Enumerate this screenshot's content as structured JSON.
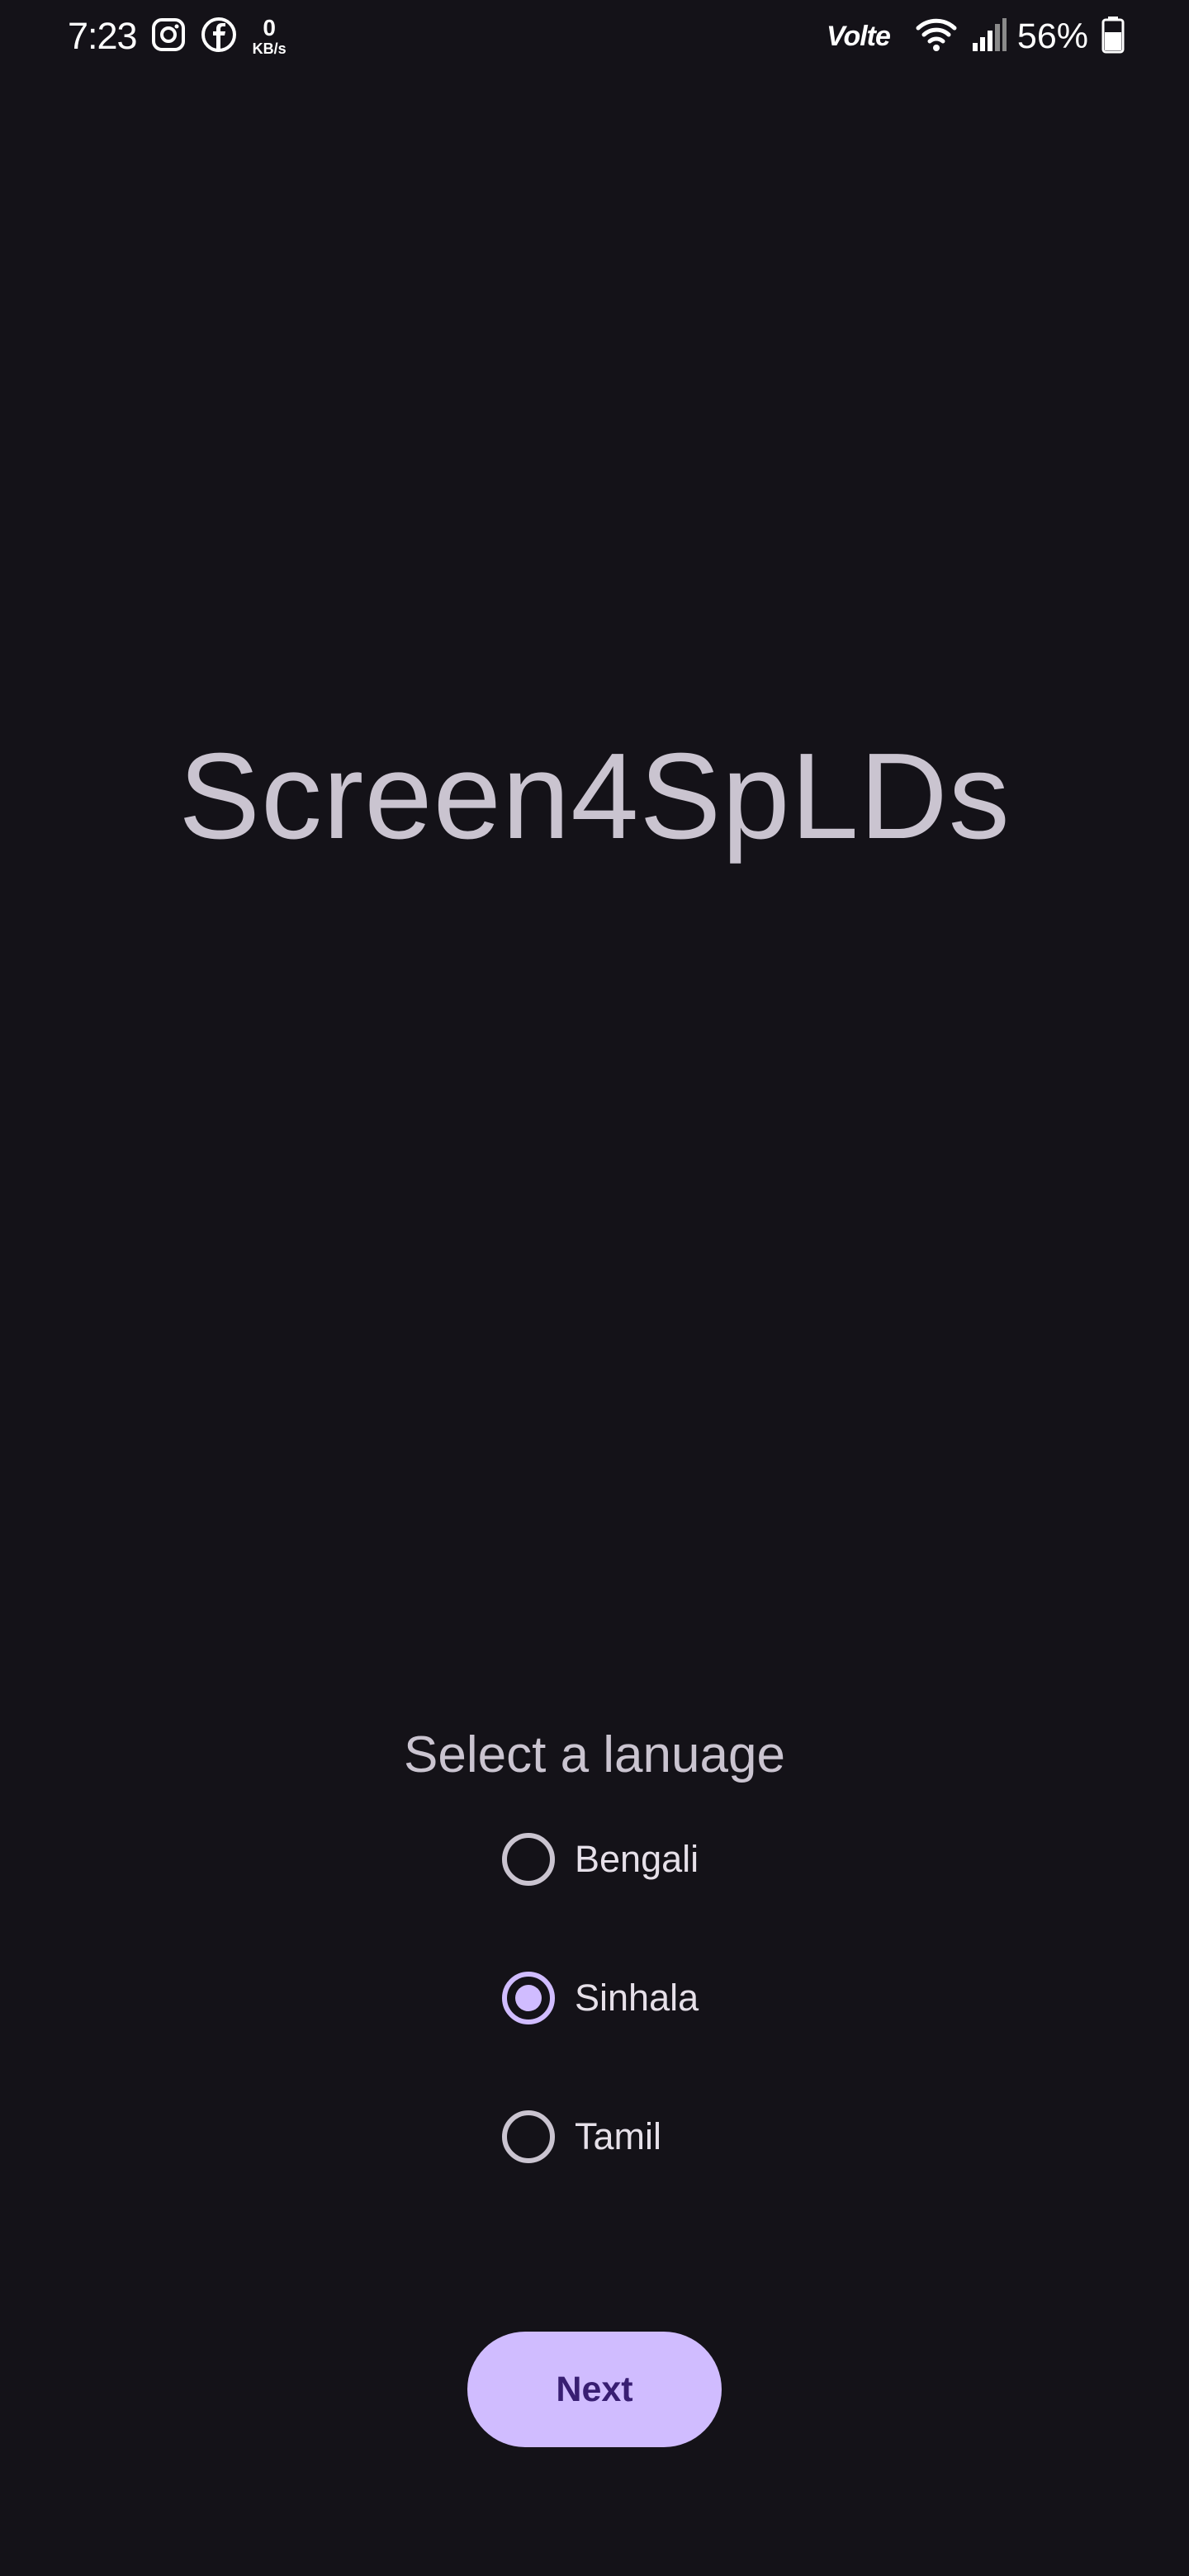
{
  "status_bar": {
    "time": "7:23",
    "left_icons": [
      "instagram-icon",
      "facebook-icon"
    ],
    "network_speed_value": "0",
    "network_speed_unit": "KB/s",
    "volte_label": "Volte",
    "battery_percent": "56%",
    "right_icons": [
      "wifi-icon",
      "cellular-signal-icon",
      "battery-icon"
    ]
  },
  "app": {
    "title": "Screen4SpLDs"
  },
  "language_selection": {
    "prompt": "Select a lanuage",
    "options": [
      {
        "label": "Bengali",
        "selected": false
      },
      {
        "label": "Sinhala",
        "selected": true
      },
      {
        "label": "Tamil",
        "selected": false
      }
    ]
  },
  "actions": {
    "next_label": "Next"
  },
  "colors": {
    "background": "#141218",
    "title_text": "#CAC4D0",
    "accent": "#D0BCFF",
    "button_text": "#381E72",
    "radio_unselected": "#CAC4D0"
  }
}
